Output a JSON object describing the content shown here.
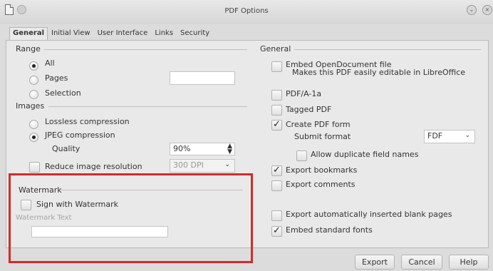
{
  "window": {
    "title": "PDF Options"
  },
  "tabs": [
    "General",
    "Initial View",
    "User Interface",
    "Links",
    "Security"
  ],
  "range": {
    "heading": "Range",
    "options": [
      "All",
      "Pages",
      "Selection"
    ],
    "pages_value": ""
  },
  "images": {
    "heading": "Images",
    "lossless": "Lossless compression",
    "jpeg": "JPEG compression",
    "quality_label": "Quality",
    "quality_value": "90%",
    "reduce": "Reduce image resolution",
    "dpi_value": "300 DPI"
  },
  "watermark": {
    "heading": "Watermark",
    "sign": "Sign with Watermark",
    "text_label": "Watermark Text",
    "text_value": ""
  },
  "general": {
    "heading": "General",
    "embed_odf": "Embed OpenDocument file",
    "embed_odf_desc": "Makes this PDF easily editable in LibreOffice",
    "pdfa": "PDF/A-1a",
    "tagged": "Tagged PDF",
    "create_form": "Create PDF form",
    "submit_label": "Submit format",
    "submit_value": "FDF",
    "allow_dup": "Allow duplicate field names",
    "export_bookmarks": "Export bookmarks",
    "export_comments": "Export comments",
    "export_blank": "Export automatically inserted blank pages",
    "embed_fonts": "Embed standard fonts"
  },
  "buttons": {
    "export": "Export",
    "cancel": "Cancel",
    "help": "Help"
  },
  "colors": {
    "highlight": "#d42a2a",
    "panel": "#e9e9e9"
  }
}
